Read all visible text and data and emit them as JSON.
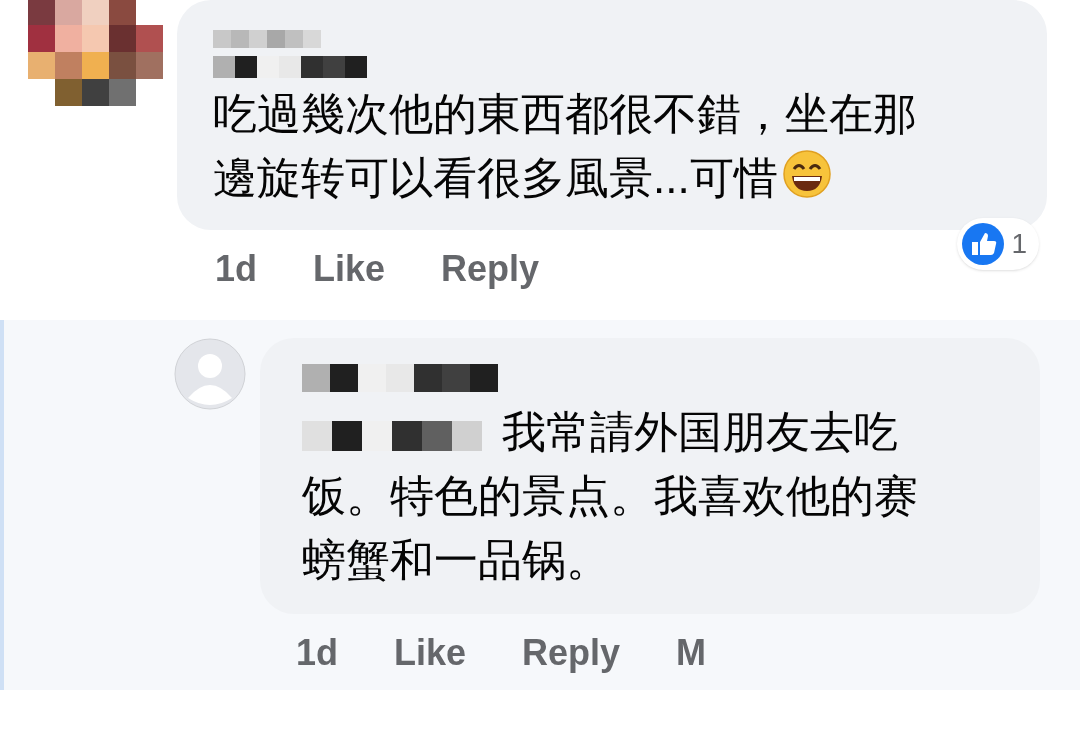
{
  "comments": [
    {
      "reply": false,
      "mention": false,
      "text": "吃過幾次他的東西都很不錯，坐在那邊旋转可以看很多風景...可惜",
      "emoji": true,
      "actions": [
        "1d",
        "Like",
        "Reply"
      ],
      "reaction_count": "1"
    },
    {
      "reply": true,
      "mention": true,
      "text": "我常請外国朋友去吃饭。特色的景点。我喜欢他的赛螃蟹和一品锅。",
      "emoji": false,
      "actions": [
        "1d",
        "Like",
        "Reply",
        "M"
      ]
    }
  ]
}
